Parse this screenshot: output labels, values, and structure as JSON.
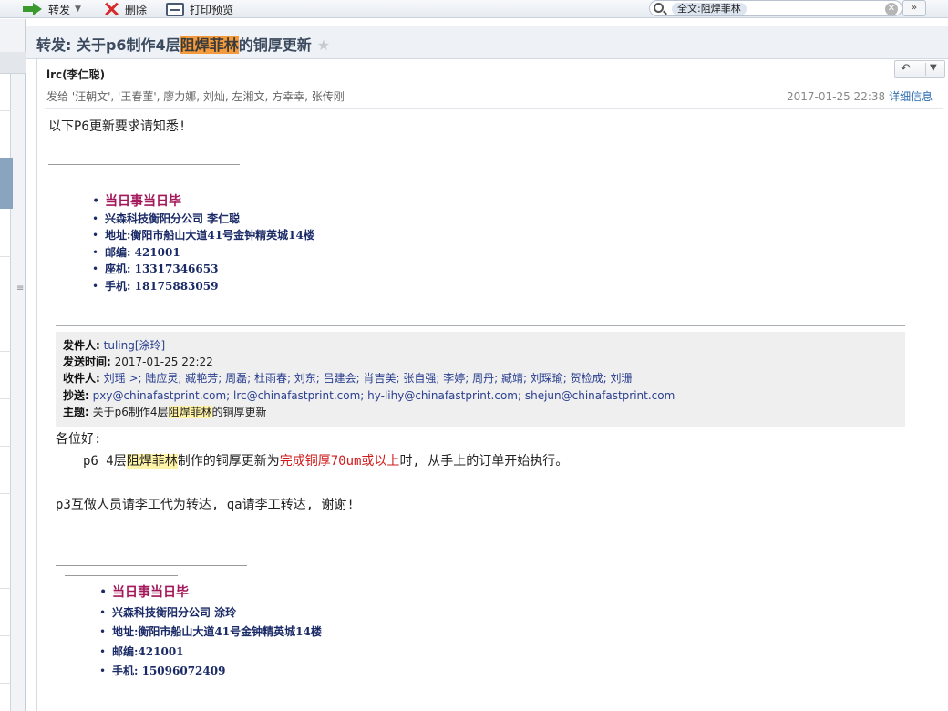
{
  "toolbar": {
    "forward_label": "转发",
    "delete_label": "删除",
    "print_label": "打印预览",
    "search_value": "全文:阻焊菲林"
  },
  "subject": {
    "prefix": "转发: 关于p6制作4层",
    "highlight": "阻焊菲林",
    "suffix": "的铜厚更新"
  },
  "header": {
    "sender": "lrc(李仁聪)",
    "recipients": "发给 '汪朝文', '王春菫', 廖力娜, 刘灿, 左湘文, 方幸幸, 张传刚",
    "date": "2017-01-25 22:38",
    "details_label": "详细信息"
  },
  "body": {
    "intro": "以下P6更新要求请知悉!"
  },
  "signature1": [
    "当日事当日毕",
    " 兴森科技衡阳分公司   李仁聪",
    "地址:衡阳市船山大道41号金钟精英城14楼",
    "邮编:  421001",
    "座机:  13317346653",
    "手机:  18175883059"
  ],
  "forwarded": {
    "from_label": "发件人:",
    "from_value": "tuling[涂玲]",
    "sent_label": "发送时间:",
    "sent_value": "2017-01-25 22:22",
    "to_label": "收件人:",
    "to_value": "刘瑶 >; 陆应灵; 臧艳芳; 周磊; 杜雨春; 刘东; 吕建会; 肖吉美; 张自强; 李婷; 周丹; 臧靖; 刘琛瑜; 贺检成; 刘珊",
    "cc_label": "抄送:",
    "cc_value": "pxy@chinafastprint.com; lrc@chinafastprint.com; hy-lihy@chinafastprint.com; shejun@chinafastprint.com",
    "subject_label": "主题:",
    "subject_prefix": "关于p6制作4层",
    "subject_highlight": "阻焊菲林",
    "subject_suffix": "的铜厚更新"
  },
  "forwarded_body": {
    "greeting": "各位好:",
    "line1_prefix": "p6   4层",
    "line1_highlight": "阻焊菲林",
    "line1_mid": "制作的铜厚更新为",
    "line1_red": "完成铜厚70um或以上",
    "line1_suffix": "时, 从手上的订单开始执行。",
    "line2": "p3互做人员请李工代为转达, qa请李工转达, 谢谢!"
  },
  "signature2": [
    "当日事当日毕",
    " 兴森科技衡阳分公司    涂玲",
    "地址:衡阳市船山大道41号金钟精英城14楼",
    "邮编:421001",
    "手机:  15096072409"
  ]
}
